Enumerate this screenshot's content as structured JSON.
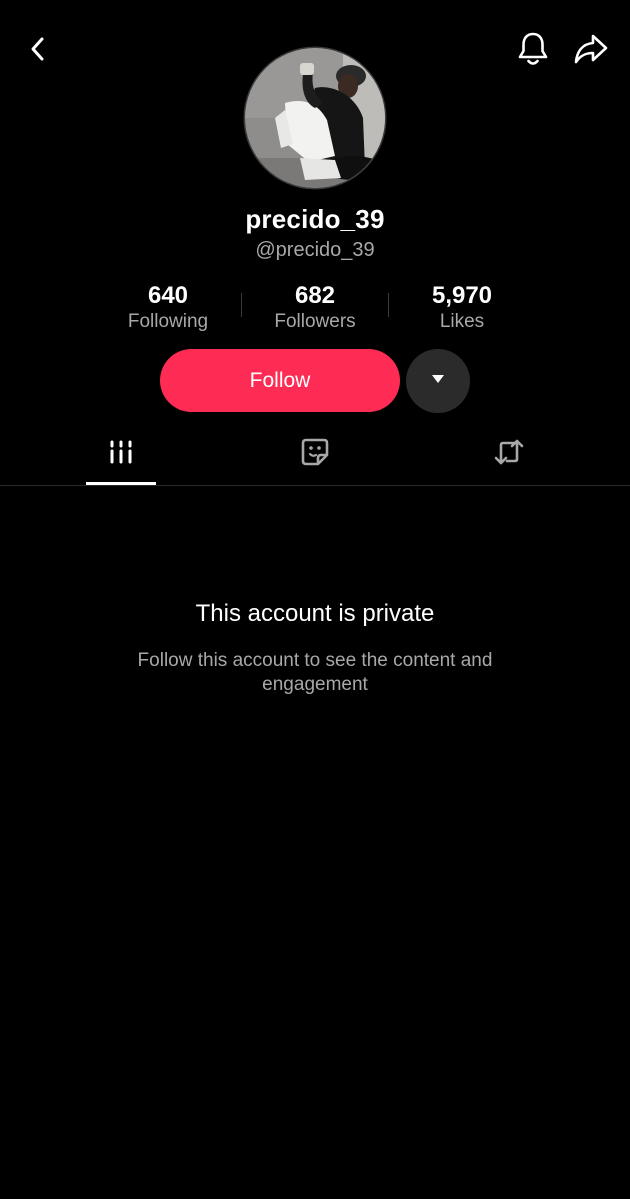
{
  "header": {
    "back_icon": "chevron-left-icon",
    "bell_icon": "bell-icon",
    "share_icon": "share-arrow-icon"
  },
  "profile": {
    "display_name": "precido_39",
    "handle": "@precido_39",
    "avatar_icon": "profile-photo"
  },
  "stats": {
    "following_value": "640",
    "following_label": "Following",
    "followers_value": "682",
    "followers_label": "Followers",
    "likes_value": "5,970",
    "likes_label": "Likes"
  },
  "actions": {
    "follow_label": "Follow",
    "dropdown_icon": "caret-down-icon"
  },
  "tabs": [
    {
      "name": "videos",
      "icon": "grid-bars-icon",
      "active": true
    },
    {
      "name": "favorites",
      "icon": "sticker-icon",
      "active": false
    },
    {
      "name": "reposts",
      "icon": "repost-icon",
      "active": false
    }
  ],
  "private_notice": {
    "title": "This account is private",
    "description": "Follow this account to see the content and engagement"
  },
  "colors": {
    "background": "#000000",
    "accent": "#fe2c55",
    "secondary_text": "#a8a8a8",
    "dropdown_bg": "#2b2b2b"
  }
}
